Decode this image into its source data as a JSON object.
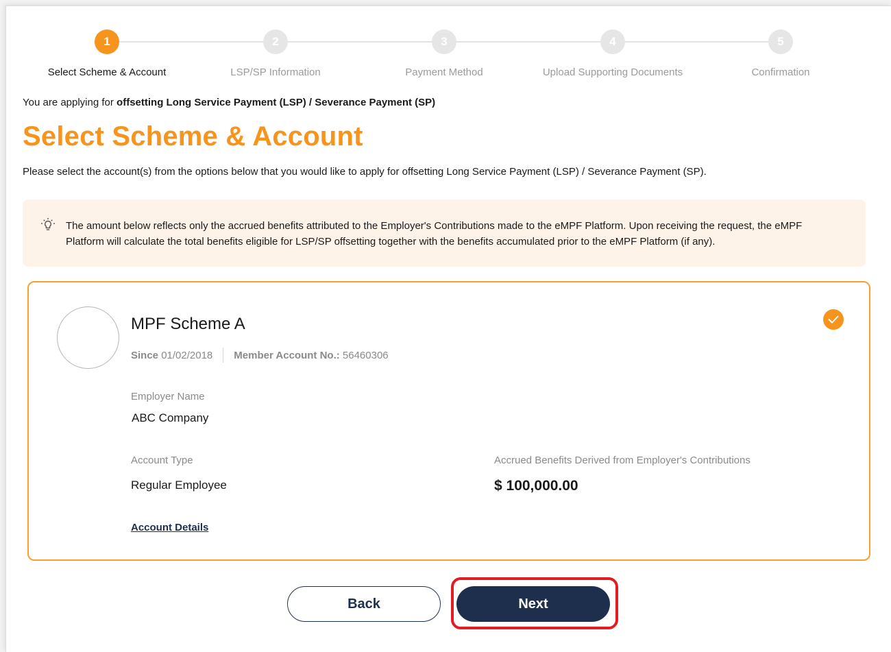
{
  "stepper": {
    "steps": [
      {
        "number": "1",
        "label": "Select Scheme & Account",
        "active": true
      },
      {
        "number": "2",
        "label": "LSP/SP Information",
        "active": false
      },
      {
        "number": "3",
        "label": "Payment Method",
        "active": false
      },
      {
        "number": "4",
        "label": "Upload Supporting Documents",
        "active": false
      },
      {
        "number": "5",
        "label": "Confirmation",
        "active": false
      }
    ]
  },
  "intro": {
    "prefix": "You are applying for ",
    "subject": "offsetting Long Service Payment (LSP) / Severance Payment (SP)"
  },
  "page_title": "Select Scheme & Account",
  "description": "Please select the account(s) from the options below that you would like to apply for offsetting Long Service Payment (LSP) / Severance Payment (SP).",
  "notice": {
    "icon": "lightbulb-icon",
    "text": "The amount below reflects only the accrued benefits attributed to the Employer's Contributions made to the eMPF Platform. Upon receiving the request, the eMPF Platform will calculate the total benefits eligible for LSP/SP offsetting together with the benefits accumulated prior to the eMPF Platform (if any)."
  },
  "account_card": {
    "scheme_name": "MPF Scheme A",
    "since_label": "Since",
    "since_date": "01/02/2018",
    "member_account_label": "Member Account No.:",
    "member_account_no": "56460306",
    "employer_name_label": "Employer Name",
    "employer_name": "ABC Company",
    "account_type_label": "Account Type",
    "account_type": "Regular Employee",
    "accrued_label": "Accrued Benefits Derived from Employer's Contributions",
    "accrued_amount": "$ 100,000.00",
    "details_link": "Account Details",
    "selected": true
  },
  "buttons": {
    "back": "Back",
    "next": "Next"
  },
  "colors": {
    "accent": "#f7941d",
    "navy": "#1e2f4d",
    "highlight": "#e31b23",
    "notice_bg": "#fdf3e9"
  }
}
